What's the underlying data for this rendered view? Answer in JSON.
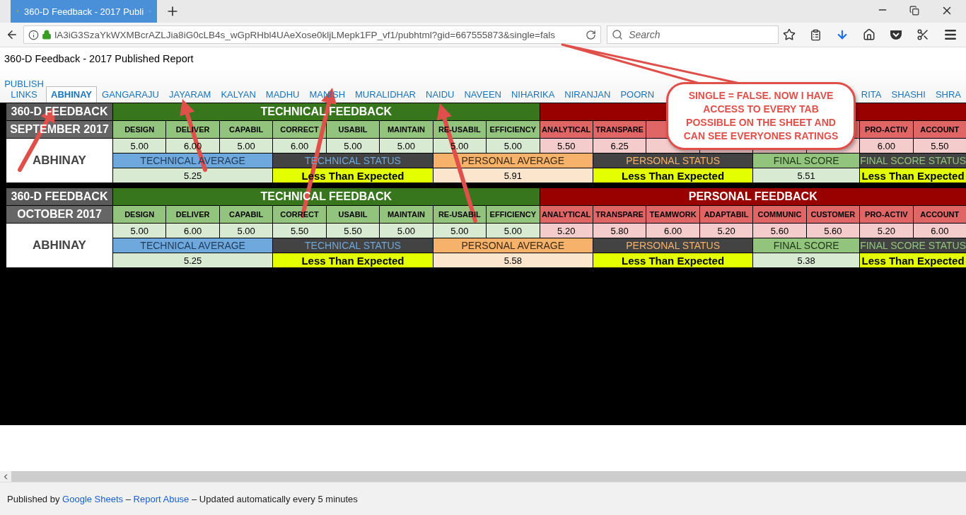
{
  "browser": {
    "tab_title": "360-D Feedback - 2017 Publi",
    "url": "lA3iG3SzaYkWXMBcrAZLJia8iG0cLB4s_wGpRHbl4UAeXose0kljLMepk1FP_vf1/pubhtml?gid=667555873&single=fals",
    "search_placeholder": "Search"
  },
  "page_title": "360-D Feedback - 2017 Published Report",
  "sheet_tabs": [
    {
      "label": "PUBLISH LINKS",
      "selected": false
    },
    {
      "label": "ABHINAY",
      "selected": true
    },
    {
      "label": "GANGARAJU",
      "selected": false
    },
    {
      "label": "JAYARAM",
      "selected": false
    },
    {
      "label": "KALYAN",
      "selected": false
    },
    {
      "label": "MADHU",
      "selected": false
    },
    {
      "label": "MANISH",
      "selected": false
    },
    {
      "label": "MURALIDHAR",
      "selected": false
    },
    {
      "label": "NAIDU",
      "selected": false
    },
    {
      "label": "NAVEEN",
      "selected": false
    },
    {
      "label": "NIHARIKA",
      "selected": false
    },
    {
      "label": "NIRANJAN",
      "selected": false
    },
    {
      "label": "POORN",
      "selected": false
    },
    {
      "label": "RITA",
      "selected": false
    },
    {
      "label": "SHASHI",
      "selected": false
    },
    {
      "label": "SHRA",
      "selected": false
    }
  ],
  "blocks": [
    {
      "title": "360-D FEEDBACK",
      "period": "SEPTEMBER 2017",
      "name": "ABHINAY",
      "sections": [
        {
          "kind": "technical",
          "title": "TECHNICAL FEEDBACK"
        },
        {
          "kind": "personal"
        }
      ],
      "columns": [
        {
          "kind": "technical",
          "label": "DESIGN",
          "value": "5.00"
        },
        {
          "kind": "technical",
          "label": "DELIVER",
          "value": "6.00"
        },
        {
          "kind": "technical",
          "label": "CAPABIL",
          "value": "5.00"
        },
        {
          "kind": "technical",
          "label": "CORRECT",
          "value": "6.00"
        },
        {
          "kind": "technical",
          "label": "USABIL",
          "value": "5.00"
        },
        {
          "kind": "technical",
          "label": "MAINTAIN",
          "value": "5.00"
        },
        {
          "kind": "technical",
          "label": "RE-USABIL",
          "value": "5.00"
        },
        {
          "kind": "technical",
          "label": "EFFICIENCY",
          "value": "5.00"
        },
        {
          "kind": "personal",
          "label": "ANALYTICAL",
          "value": "5.50"
        },
        {
          "kind": "personal",
          "label": "TRANSPARE",
          "value": "6.25"
        },
        {
          "kind": "personal"
        },
        {
          "kind": "personal"
        },
        {
          "kind": "personal"
        },
        {
          "kind": "personal"
        },
        {
          "kind": "personal",
          "label": "PRO-ACTIV",
          "value": "6.00"
        },
        {
          "kind": "personal",
          "label": "ACCOUNT",
          "value": "5.50"
        }
      ],
      "summary": [
        {
          "kind": "technical_average",
          "label": "TECHNICAL AVERAGE",
          "value": "5.25"
        },
        {
          "kind": "technical_status",
          "label": "TECHNICAL STATUS",
          "value": "Less Than Expected"
        },
        {
          "kind": "personal_average",
          "label": "PERSONAL AVERAGE",
          "value": "5.91"
        },
        {
          "kind": "personal_status",
          "label": "PERSONAL STATUS",
          "value": "Less Than Expected"
        },
        {
          "kind": "final_score",
          "label": "FINAL SCORE",
          "value": "5.51"
        },
        {
          "kind": "final_score_status",
          "label": "FINAL SCORE STATUS",
          "value": "Less Than Expected"
        }
      ]
    },
    {
      "title": "360-D FEEDBACK",
      "period": "OCTOBER 2017",
      "name": "ABHINAY",
      "sections": [
        {
          "kind": "technical",
          "title": "TECHNICAL FEEDBACK"
        },
        {
          "kind": "personal",
          "title": "PERSONAL FEEDBACK"
        }
      ],
      "columns": [
        {
          "kind": "technical",
          "label": "DESIGN",
          "value": "5.00"
        },
        {
          "kind": "technical",
          "label": "DELIVER",
          "value": "6.00"
        },
        {
          "kind": "technical",
          "label": "CAPABIL",
          "value": "5.00"
        },
        {
          "kind": "technical",
          "label": "CORRECT",
          "value": "5.50"
        },
        {
          "kind": "technical",
          "label": "USABIL",
          "value": "5.50"
        },
        {
          "kind": "technical",
          "label": "MAINTAIN",
          "value": "5.00"
        },
        {
          "kind": "technical",
          "label": "RE-USABIL",
          "value": "5.00"
        },
        {
          "kind": "technical",
          "label": "EFFICIENCY",
          "value": "5.00"
        },
        {
          "kind": "personal",
          "label": "ANALYTICAL",
          "value": "5.20"
        },
        {
          "kind": "personal",
          "label": "TRANSPARE",
          "value": "5.80"
        },
        {
          "kind": "personal",
          "label": "TEAMWORK",
          "value": "6.00"
        },
        {
          "kind": "personal",
          "label": "ADAPTABIL",
          "value": "5.20"
        },
        {
          "kind": "personal",
          "label": "COMMUNIC",
          "value": "5.60"
        },
        {
          "kind": "personal",
          "label": "CUSTOMER",
          "value": "5.60"
        },
        {
          "kind": "personal",
          "label": "PRO-ACTIV",
          "value": "5.20"
        },
        {
          "kind": "personal",
          "label": "ACCOUNT",
          "value": "6.00"
        }
      ],
      "summary": [
        {
          "kind": "technical_average",
          "label": "TECHNICAL AVERAGE",
          "value": "5.25"
        },
        {
          "kind": "technical_status",
          "label": "TECHNICAL STATUS",
          "value": "Less Than Expected"
        },
        {
          "kind": "personal_average",
          "label": "PERSONAL AVERAGE",
          "value": "5.58"
        },
        {
          "kind": "personal_status",
          "label": "PERSONAL STATUS",
          "value": "Less Than Expected"
        },
        {
          "kind": "final_score",
          "label": "FINAL SCORE",
          "value": "5.38"
        },
        {
          "kind": "final_score_status",
          "label": "FINAL SCORE STATUS",
          "value": "Less Than Expected"
        }
      ]
    }
  ],
  "callout": {
    "text": "SINGLE = FALSE. NOW I HAVE ACCESS TO EVERY TAB POSSIBLE ON THE SHEET AND CAN SEE EVERYONES RATINGS"
  },
  "footer": [
    {
      "kind": "text",
      "text": "Published by"
    },
    {
      "kind": "link",
      "text": "Google Sheets"
    },
    {
      "kind": "text",
      "text": "–"
    },
    {
      "kind": "link",
      "text": "Report Abuse"
    },
    {
      "kind": "text",
      "text": "– Updated automatically every 5 minutes"
    }
  ]
}
